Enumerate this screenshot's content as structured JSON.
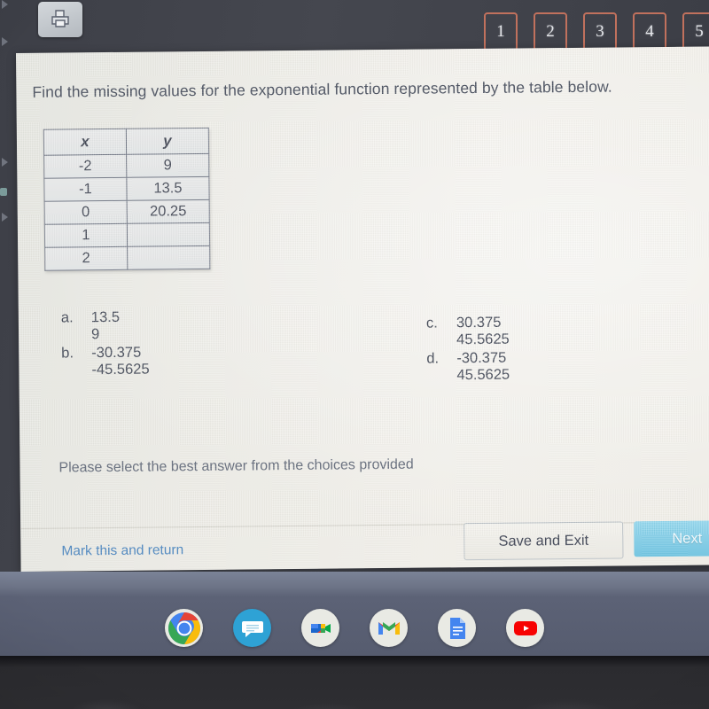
{
  "toolbar": {
    "print_icon": "printer-icon",
    "question_numbers": [
      "1",
      "2",
      "3",
      "4",
      "5"
    ]
  },
  "quiz": {
    "question": "Find the missing values for the exponential function represented by the table below.",
    "table": {
      "headers": [
        "x",
        "y"
      ],
      "rows": [
        [
          "-2",
          "9"
        ],
        [
          "-1",
          "13.5"
        ],
        [
          "0",
          "20.25"
        ],
        [
          "1",
          ""
        ],
        [
          "2",
          ""
        ]
      ]
    },
    "choices": [
      {
        "letter": "a.",
        "line1": "13.5",
        "line2": "9"
      },
      {
        "letter": "b.",
        "line1": "-30.375",
        "line2": "-45.5625"
      },
      {
        "letter": "c.",
        "line1": "30.375",
        "line2": "45.5625"
      },
      {
        "letter": "d.",
        "line1": "-30.375",
        "line2": "45.5625"
      }
    ],
    "instruction": "Please select the best answer from the choices provided"
  },
  "footer": {
    "mark_link": "Mark this and return",
    "save_button": "Save and Exit",
    "next_button": "Next"
  },
  "shelf": {
    "icons": [
      "chrome-icon",
      "messages-icon",
      "google-meet-icon",
      "gmail-icon",
      "google-docs-icon",
      "youtube-icon"
    ]
  },
  "colors": {
    "page_background": "#efede7",
    "text": "#3f4656",
    "question_box_border": "#c4705c",
    "link_blue": "#3f7fbf",
    "next_button": "#63c3e3",
    "shelf": "#5c6277",
    "table_border": "#6d7382"
  }
}
